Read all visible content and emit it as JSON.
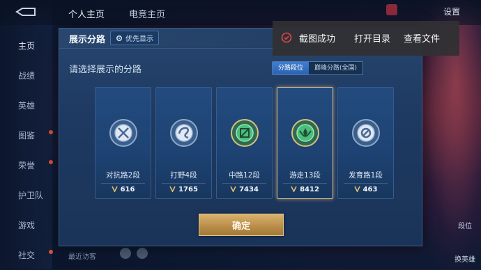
{
  "topbar": {
    "tabs": [
      "个人主页",
      "电竞主页"
    ],
    "settings_label": "设置"
  },
  "sidebar": {
    "items": [
      {
        "label": "主页"
      },
      {
        "label": "战绩"
      },
      {
        "label": "英雄"
      },
      {
        "label": "图鉴"
      },
      {
        "label": "荣誉"
      },
      {
        "label": "护卫队"
      },
      {
        "label": "游戏"
      },
      {
        "label": "社交"
      }
    ]
  },
  "bottom": {
    "hint": "最近访客"
  },
  "right_panel": {
    "button1": "段位",
    "button2": "换英雄"
  },
  "modal": {
    "title": "展示分路",
    "priority_label": "优先显示",
    "subtitle": "请选择展示的分路",
    "segments": [
      "分路段位",
      "巅峰分路(全国)"
    ],
    "cards": [
      {
        "name": "对抗路2段",
        "score": "616",
        "icon": "sword-cross-icon",
        "color": "#c9d6e6"
      },
      {
        "name": "打野4段",
        "score": "1765",
        "icon": "swirl-icon",
        "color": "#c9d6e6"
      },
      {
        "name": "中路12段",
        "score": "7434",
        "icon": "diagonal-slash-icon",
        "color": "#4ec37a"
      },
      {
        "name": "游走13段",
        "score": "8412",
        "icon": "leaf-guard-icon",
        "color": "#4ec37a"
      },
      {
        "name": "发育路1段",
        "score": "463",
        "icon": "target-icon",
        "color": "#c9d6e6"
      }
    ],
    "confirm_label": "确定"
  },
  "toast": {
    "message": "截图成功",
    "open_dir": "打开目录",
    "view_file": "查看文件"
  },
  "colors": {
    "modal_bg": "#1e3a62",
    "accent_gold": "#d8b26e",
    "selected_border": "#d8b88a",
    "toast_bg": "#303034"
  }
}
